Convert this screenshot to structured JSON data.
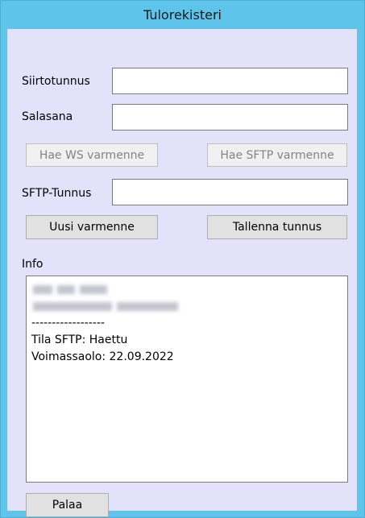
{
  "window": {
    "title": "Tulorekisteri"
  },
  "form": {
    "siirtotunnus_label": "Siirtotunnus",
    "siirtotunnus_value": "",
    "salasana_label": "Salasana",
    "salasana_value": "",
    "sftp_tunnus_label": "SFTP-Tunnus",
    "sftp_tunnus_value": ""
  },
  "buttons": {
    "hae_ws": "Hae WS varmenne",
    "hae_sftp": "Hae SFTP varmenne",
    "uusi_varmenne": "Uusi varmenne",
    "tallenna_tunnus": "Tallenna tunnus",
    "palaa": "Palaa"
  },
  "info": {
    "label": "Info",
    "separator": "------------------",
    "tila_sftp": "Tila SFTP: Haettu",
    "voimassaolo": "Voimassaolo: 22.09.2022"
  },
  "colors": {
    "titlebar": "#5ec4ea",
    "client_background": "#e4e2fb",
    "button_background": "#e1e1e1"
  }
}
